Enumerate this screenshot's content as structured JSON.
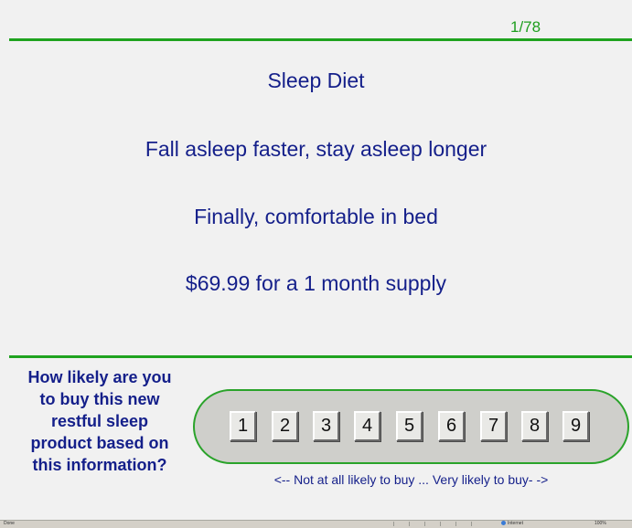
{
  "header": {
    "counter": "1/78"
  },
  "ad": {
    "lines": [
      "Sleep Diet",
      "Fall asleep faster, stay asleep longer",
      "Finally, comfortable in bed",
      "$69.99 for a 1 month supply"
    ]
  },
  "survey": {
    "question_lines": [
      "How likely are you",
      "to buy this new",
      "restful sleep",
      "product based on",
      "this information?"
    ],
    "options": [
      "1",
      "2",
      "3",
      "4",
      "5",
      "6",
      "7",
      "8",
      "9"
    ],
    "caption": "<-- Not at all likely to buy ... Very likely to buy- ->"
  },
  "statusbar": {
    "status": "Done",
    "zone": "Internet",
    "zoom": "100%"
  },
  "colors": {
    "accent_green": "#1fa31f",
    "text_navy": "#141f8a",
    "background": "#f1f1f1"
  }
}
